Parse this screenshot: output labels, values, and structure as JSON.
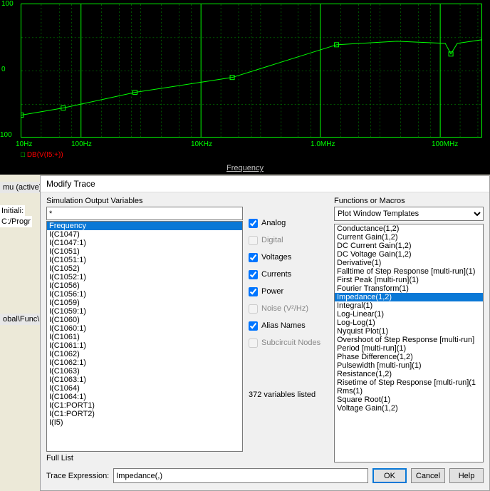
{
  "chart_data": {
    "type": "line",
    "title": "",
    "xlabel": "Frequency",
    "ylabel": "",
    "xscale": "log",
    "xlim": [
      10,
      500000000.0
    ],
    "ylim": [
      -100,
      100
    ],
    "yticks": [
      -100,
      0,
      100
    ],
    "xticks": [
      "10Hz",
      "100Hz",
      "10KHz",
      "1.0MHz",
      "100MHz"
    ],
    "series": [
      {
        "name": "DB(V(I5:+))",
        "color": "#00ff00",
        "x": [
          10,
          50,
          300,
          5000,
          80000,
          400000,
          3000000,
          30000000,
          50000000,
          100000000,
          500000000
        ],
        "y": [
          -65,
          -55,
          -32,
          -10,
          15,
          40,
          45,
          40,
          20,
          40,
          45
        ]
      }
    ],
    "grid": true
  },
  "legend_text": "DB(V(I5:+))",
  "side": {
    "tab1": "mu (active)",
    "line1": "Initiali:",
    "line2": "C:/Progr",
    "tab2": "obal\\Func\\"
  },
  "dialog": {
    "title": "Modify Trace",
    "sim_label": "Simulation Output Variables",
    "filter_value": "*",
    "list": [
      "Frequency",
      "I(C1047)",
      "I(C1047:1)",
      "I(C1051)",
      "I(C1051:1)",
      "I(C1052)",
      "I(C1052:1)",
      "I(C1056)",
      "I(C1056:1)",
      "I(C1059)",
      "I(C1059:1)",
      "I(C1060)",
      "I(C1060:1)",
      "I(C1061)",
      "I(C1061:1)",
      "I(C1062)",
      "I(C1062:1)",
      "I(C1063)",
      "I(C1063:1)",
      "I(C1064)",
      "I(C1064:1)",
      "I(C1:PORT1)",
      "I(C1:PORT2)",
      "I(I5)"
    ],
    "list_selected": 0,
    "filter_label": "Full List",
    "checks": [
      {
        "label": "Analog",
        "checked": true,
        "enabled": true
      },
      {
        "label": "Digital",
        "checked": false,
        "enabled": false
      },
      {
        "label": "Voltages",
        "checked": true,
        "enabled": true
      },
      {
        "label": "Currents",
        "checked": true,
        "enabled": true
      },
      {
        "label": "Power",
        "checked": true,
        "enabled": true
      },
      {
        "label": "Noise (V²/Hz)",
        "checked": false,
        "enabled": false
      },
      {
        "label": "Alias Names",
        "checked": true,
        "enabled": true
      },
      {
        "label": "Subcircuit Nodes",
        "checked": false,
        "enabled": false
      }
    ],
    "stat": "372 variables listed",
    "func_label": "Functions or Macros",
    "combo_value": "Plot Window Templates",
    "rlist": [
      "Conductance(1,2)",
      "Current Gain(1,2)",
      "DC Current Gain(1,2)",
      "DC Voltage Gain(1,2)",
      "Derivative(1)",
      "Falltime of Step Response [multi-run](1)",
      "First Peak [multi-run](1)",
      "Fourier Transform(1)",
      "Impedance(1,2)",
      "Integral(1)",
      "Log-Linear(1)",
      "Log-Log(1)",
      "Nyquist Plot(1)",
      "Overshoot of Step Response [multi-run]",
      "Period [multi-run](1)",
      "Phase Difference(1,2)",
      "Pulsewidth [multi-run](1)",
      "Resistance(1,2)",
      "Risetime of Step Response [multi-run](1",
      "Rms(1)",
      "Square Root(1)",
      "Voltage Gain(1,2)"
    ],
    "rlist_selected": 8,
    "expr_label": "Trace Expression:",
    "expr_value": "Impedance(,)",
    "btn_ok": "OK",
    "btn_cancel": "Cancel",
    "btn_help": "Help"
  }
}
